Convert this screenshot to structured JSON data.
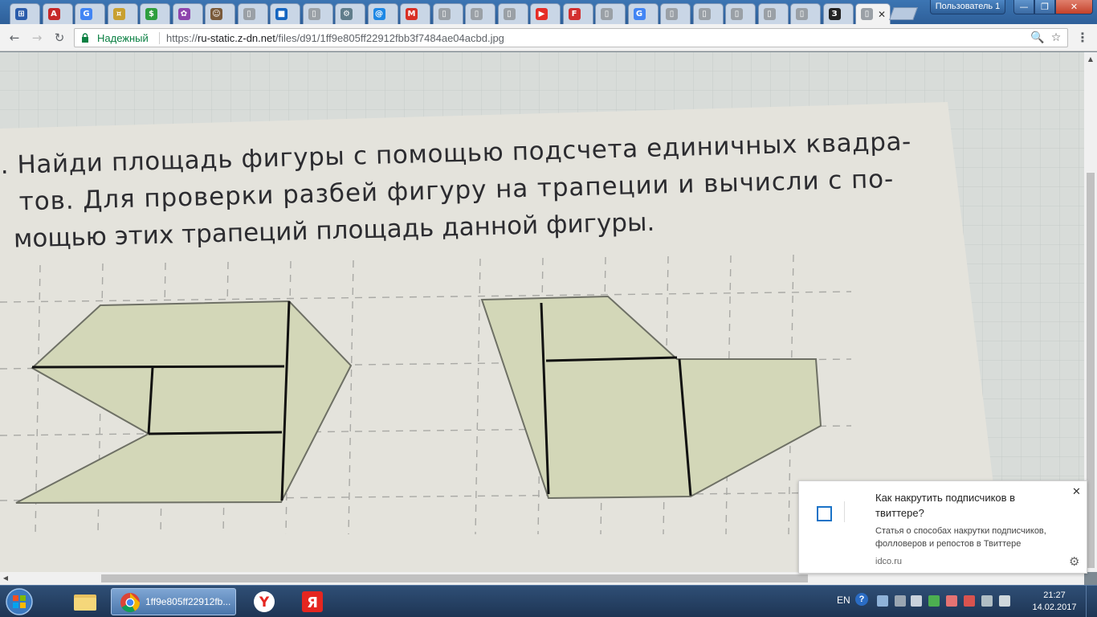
{
  "window": {
    "user_label": "Пользователь 1",
    "minimize_glyph": "—",
    "maximize_glyph": "❐",
    "close_glyph": "✕"
  },
  "tabs": [
    {
      "icon": "grid-icon",
      "color": "#2b5cab",
      "glyph": "⊞"
    },
    {
      "icon": "pdf-icon",
      "color": "#c62828",
      "glyph": "A"
    },
    {
      "icon": "google-icon",
      "color": "#4285f4",
      "glyph": "G"
    },
    {
      "icon": "coins-icon",
      "color": "#c8a030",
      "glyph": "¤"
    },
    {
      "icon": "dollar-icon",
      "color": "#2e9e3e",
      "glyph": "$"
    },
    {
      "icon": "flower-icon",
      "color": "#8e44ad",
      "glyph": "✿"
    },
    {
      "icon": "avatar-icon",
      "color": "#7a5a3a",
      "glyph": "☺"
    },
    {
      "icon": "page-icon",
      "color": "#9aa0a6",
      "glyph": "▯"
    },
    {
      "icon": "blue-square-icon",
      "color": "#1565c0",
      "glyph": "■"
    },
    {
      "icon": "page-icon",
      "color": "#9aa0a6",
      "glyph": "▯"
    },
    {
      "icon": "gear-wheel-icon",
      "color": "#607d8b",
      "glyph": "⚙"
    },
    {
      "icon": "at-icon",
      "color": "#1e88e5",
      "glyph": "@"
    },
    {
      "icon": "gmail-icon",
      "color": "#d93025",
      "glyph": "M"
    },
    {
      "icon": "page-icon",
      "color": "#9aa0a6",
      "glyph": "▯"
    },
    {
      "icon": "page-icon",
      "color": "#9aa0a6",
      "glyph": "▯"
    },
    {
      "icon": "page-icon",
      "color": "#9aa0a6",
      "glyph": "▯"
    },
    {
      "icon": "youtube-icon",
      "color": "#e52d27",
      "glyph": "▶"
    },
    {
      "icon": "f-icon",
      "color": "#d32f2f",
      "glyph": "F"
    },
    {
      "icon": "page-icon",
      "color": "#9aa0a6",
      "glyph": "▯"
    },
    {
      "icon": "google-icon",
      "color": "#4285f4",
      "glyph": "G"
    },
    {
      "icon": "page-icon",
      "color": "#9aa0a6",
      "glyph": "▯"
    },
    {
      "icon": "page-icon",
      "color": "#9aa0a6",
      "glyph": "▯"
    },
    {
      "icon": "page-icon",
      "color": "#9aa0a6",
      "glyph": "▯"
    },
    {
      "icon": "page-icon",
      "color": "#9aa0a6",
      "glyph": "▯"
    },
    {
      "icon": "page-icon",
      "color": "#9aa0a6",
      "glyph": "▯"
    },
    {
      "icon": "znanija-icon",
      "color": "#222222",
      "glyph": "З"
    },
    {
      "icon": "page-icon",
      "color": "#9aa0a6",
      "glyph": "▯",
      "active": true
    }
  ],
  "toolbar": {
    "back": "←",
    "forward": "→",
    "reload": "↻",
    "secure_label": "Надежный",
    "url_scheme": "https://",
    "url_host": "ru-static.z-dn.net",
    "url_path": "/files/d91/1ff9e805ff22912fbb3f7484ae04acbd.jpg",
    "zoom": "🔍",
    "star": "☆",
    "menu": "⋮"
  },
  "photo": {
    "task_lines": [
      ". Найди площадь фигуры с помощью подсчета единичных квадра-",
      "тов. Для проверки разбей фигуру на трапеции и вычисли с по-",
      "мощью этих трапеций площадь данной фигуры."
    ],
    "figure_fill": "#d3d7b8",
    "paper": "#e6e5de",
    "ink": "#111111"
  },
  "notification": {
    "title": "Как накрутить подписчиков в твиттере?",
    "body": "Статья о способах накрутки подписчиков, фолловеров и репостов в Твиттере",
    "source": "idco.ru",
    "close": "✕",
    "gear": "⚙"
  },
  "taskbar": {
    "chrome_label": "1ff9e805ff22912fb...",
    "lang": "EN",
    "help": "?",
    "time": "21:27",
    "date": "14.02.2017"
  }
}
